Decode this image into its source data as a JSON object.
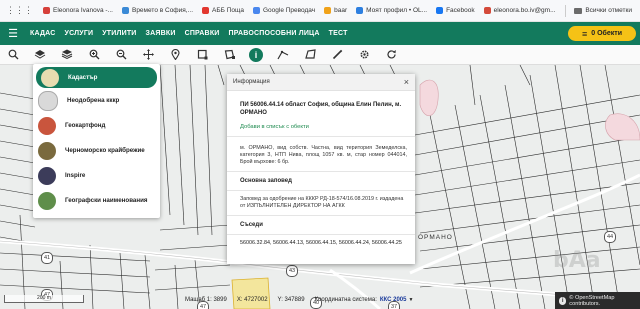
{
  "bookmarks": {
    "items": [
      {
        "label": "Eleonora Ivanova -...",
        "color": "#d6403a"
      },
      {
        "label": "Времето в София,...",
        "color": "#3b8ad6"
      },
      {
        "label": "АББ Поща",
        "color": "#e2372f"
      },
      {
        "label": "Google Преводач",
        "color": "#4a87ee"
      },
      {
        "label": "baar",
        "color": "#f0a21a"
      },
      {
        "label": "Моят профил • OL...",
        "color": "#2d7fe0"
      },
      {
        "label": "Facebook",
        "color": "#1877f2"
      },
      {
        "label": "eleonora.bo.iv@gm...",
        "color": "#d44a3a"
      }
    ],
    "all_label": "Всички отметки"
  },
  "header": {
    "nav": [
      "КАДАС",
      "УСЛУГИ",
      "УТИЛИТИ",
      "ЗАЯВКИ",
      "СПРАВКИ",
      "ПРАВОСПОСОБНИ ЛИЦА",
      "ТЕСТ"
    ],
    "objects_label": "0 Обекти",
    "accent": "#137a5d",
    "button_color": "#f5c216"
  },
  "toolbar": {
    "tools": [
      "search-icon",
      "layers-icon",
      "stack-icon",
      "zoom-in-icon",
      "zoom-out-icon",
      "pan-icon",
      "pin-icon",
      "select-box-icon",
      "select-free-icon",
      "info-icon",
      "measure-icon",
      "area-icon",
      "draw-icon",
      "settings-icon",
      "reload-icon"
    ],
    "active_tool": "info-icon"
  },
  "layers": {
    "items": [
      {
        "label": "Кадастър",
        "selected": true
      },
      {
        "label": "Неодобрена кккр",
        "selected": false
      },
      {
        "label": "Геокартфонд",
        "selected": false
      },
      {
        "label": "Черноморско крайбрежие",
        "selected": false
      },
      {
        "label": "Inspire",
        "selected": false
      },
      {
        "label": "Географски наименования",
        "selected": false
      }
    ]
  },
  "info": {
    "header": "Информация",
    "close": "×",
    "title": "ПИ 56006.44.14 област София, община Елин Пелин, м. ОРМАНО",
    "add_to_list": "Добави в списък с обекти",
    "description": "м. ОРМАНО, вид собств. Частна, вид територия Земеделска, категория 3, НТП Нива, площ 1057 кв. м, стар номер 044014, Брой върхове: 6 бр.",
    "order_heading": "Основна заповед",
    "order_text": "Заповед за одобрение на КККР РД-18-574/16.08.2019 г. издадена от ИЗПЪЛНИТЕЛЕН ДИРЕКТОР НА АГКК",
    "neighbors_heading": "Съседи",
    "neighbors": "56006.32.84,   56006.44.13,   56006.44.15,   56006.44.24, 56006.44.25"
  },
  "map": {
    "labels": [
      "41",
      "47",
      "47",
      "43",
      "40",
      "37",
      "44",
      "ОРМАНО"
    ],
    "scale_label": "200 m",
    "attribution": "© OpenStreetMap contributors."
  },
  "status": {
    "scale_label": "Мащаб 1:",
    "scale_value": "3899",
    "x_label": "X:",
    "x_value": "4727002",
    "y_label": "Y:",
    "y_value": "347889",
    "coord_label": "Координатна система:",
    "coord_value": "ККС 2005"
  }
}
